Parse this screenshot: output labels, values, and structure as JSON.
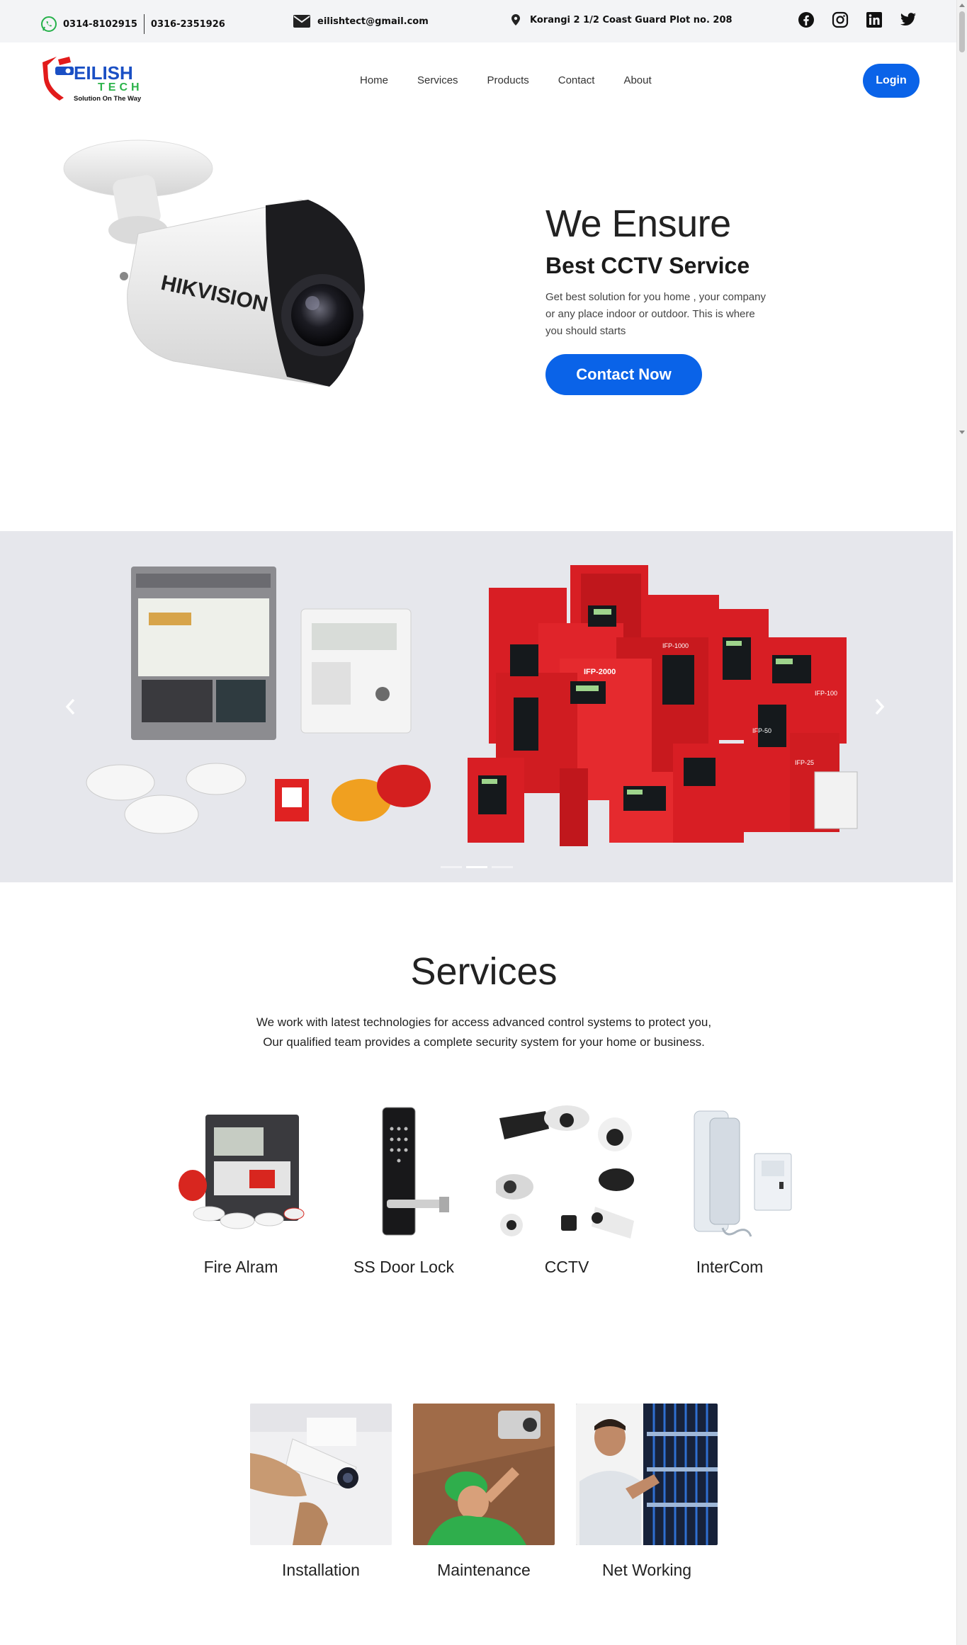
{
  "topbar": {
    "phone1": "0314-8102915",
    "phone2": "0316-2351926",
    "email": "eilishtect@gmail.com",
    "address": "Korangi 2 1/2 Coast Guard Plot no. 208",
    "social": [
      "facebook-icon",
      "instagram-icon",
      "linkedin-icon",
      "twitter-icon"
    ]
  },
  "logo": {
    "line1": "EILISH",
    "line2": "TECH",
    "tagline": "Solution On The Way"
  },
  "nav": {
    "links": [
      "Home",
      "Services",
      "Products",
      "Contact",
      "About"
    ],
    "login": "Login"
  },
  "hero": {
    "title": "We Ensure",
    "subtitle": "Best CCTV Service",
    "description": "Get best solution for you home , your company or any place indoor or outdoor. This is where you should starts",
    "cta": "Contact Now",
    "camera_brand": "HIKVISION"
  },
  "carousel": {
    "slides": 3,
    "active_slide": 2,
    "panel_labels": [
      "IFP-2000",
      "IFP-1000",
      "IFP-50",
      "IFP-25",
      "IFP-100"
    ]
  },
  "services": {
    "title": "Services",
    "description_line1": "We work with latest technologies for access advanced control systems to protect you,",
    "description_line2": "Our qualified team provides a complete security system for your home or business.",
    "products": [
      "Fire Alram",
      "SS Door Lock",
      "CCTV",
      "InterCom"
    ],
    "offerings": [
      "Installation",
      "Maintenance",
      "Net Working"
    ]
  },
  "colors": {
    "primary": "#0a63e8",
    "logo_red": "#e21b1b",
    "logo_blue": "#1a4fc4",
    "logo_green": "#2bb34a"
  }
}
